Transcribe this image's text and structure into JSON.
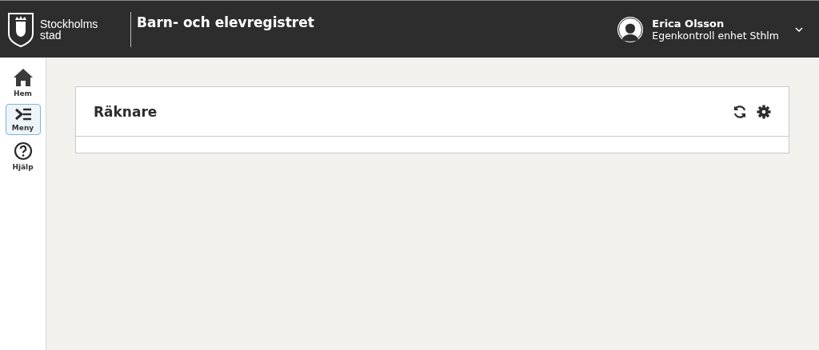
{
  "header": {
    "logo_lines": [
      "Stockholms",
      "stad"
    ],
    "app_title": "Barn- och elevregistret",
    "user": {
      "name": "Erica Olsson",
      "unit": "Egenkontroll enhet Sthlm"
    }
  },
  "sidebar": {
    "items": [
      {
        "label": "Hem",
        "kind": "home",
        "selected": false
      },
      {
        "label": "Meny",
        "kind": "menu",
        "selected": true
      },
      {
        "label": "Hjälp",
        "kind": "help",
        "selected": false
      }
    ]
  },
  "panel": {
    "title": "Räknare"
  }
}
